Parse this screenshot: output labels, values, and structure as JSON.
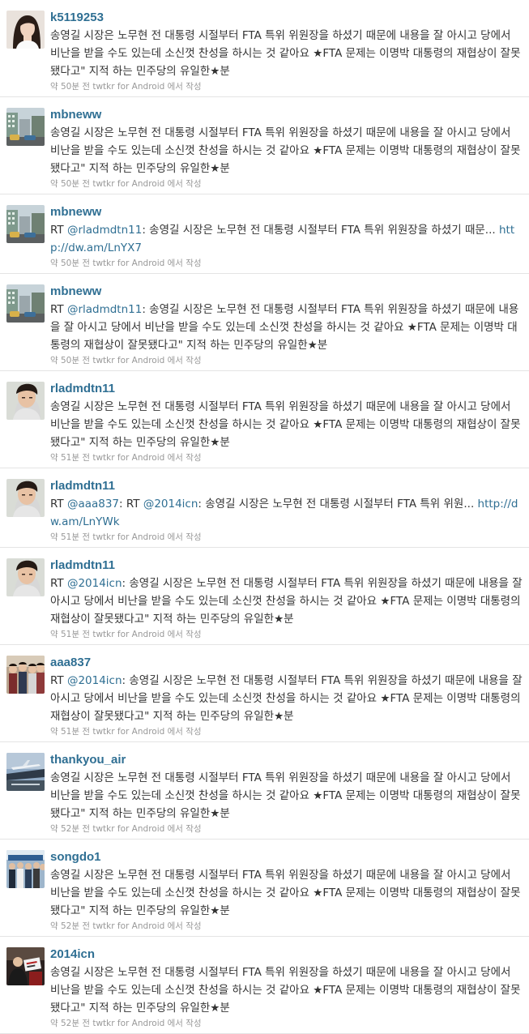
{
  "tweets": [
    {
      "username": "k5119253",
      "avatar_icon": "woman-portrait-avatar",
      "segments": [
        {
          "type": "text",
          "value": "송영길 시장은 노무현 전 대통령 시절부터 FTA 특위 위원장을 하셨기 때문에 내용을 잘 아시고 당에서 비난을 받을 수도 있는데 소신껏 찬성을 하시는 것 같아요 ★FTA 문제는 이명박 대통령의 재협상이 잘못됐다고\" 지적 하는 민주당의 유일한★분"
        }
      ],
      "meta": "약 50분 전 twtkr for Android 에서 작성"
    },
    {
      "username": "mbneww",
      "avatar_icon": "city-street-avatar",
      "segments": [
        {
          "type": "text",
          "value": "송영길 시장은 노무현 전 대통령 시절부터 FTA 특위 위원장을 하셨기 때문에 내용을 잘 아시고 당에서 비난을 받을 수도 있는데 소신껏 찬성을 하시는 것 같아요 ★FTA 문제는 이명박 대통령의 재협상이 잘못됐다고\" 지적 하는 민주당의 유일한★분"
        }
      ],
      "meta": "약 50분 전 twtkr for Android 에서 작성"
    },
    {
      "username": "mbneww",
      "avatar_icon": "city-street-avatar",
      "segments": [
        {
          "type": "text",
          "value": "RT "
        },
        {
          "type": "mention",
          "value": "@rladmdtn11"
        },
        {
          "type": "text",
          "value": ": 송영길 시장은 노무현 전 대통령 시절부터 FTA 특위 위원장을 하셨기 때문... "
        },
        {
          "type": "link",
          "value": "http://dw.am/LnYX7"
        }
      ],
      "meta": "약 50분 전 twtkr for Android 에서 작성"
    },
    {
      "username": "mbneww",
      "avatar_icon": "city-street-avatar",
      "segments": [
        {
          "type": "text",
          "value": "RT "
        },
        {
          "type": "mention",
          "value": "@rladmdtn11"
        },
        {
          "type": "text",
          "value": ": 송영길 시장은 노무현 전 대통령 시절부터 FTA 특위 위원장을 하셨기 때문에 내용을 잘 아시고 당에서 비난을 받을 수도 있는데 소신껏 찬성을 하시는 것 같아요 ★FTA 문제는 이명박 대통령의 재협상이 잘못됐다고\" 지적 하는 민주당의 유일한★분"
        }
      ],
      "meta": "약 50분 전 twtkr for Android 에서 작성"
    },
    {
      "username": "rladmdtn11",
      "avatar_icon": "boy-portrait-avatar",
      "segments": [
        {
          "type": "text",
          "value": "송영길 시장은 노무현 전 대통령 시절부터 FTA 특위 위원장을 하셨기 때문에 내용을 잘 아시고 당에서 비난을 받을 수도 있는데 소신껏 찬성을 하시는 것 같아요 ★FTA 문제는 이명박 대통령의 재협상이 잘못됐다고\" 지적 하는 민주당의 유일한★분"
        }
      ],
      "meta": "약 51분 전 twtkr for Android 에서 작성"
    },
    {
      "username": "rladmdtn11",
      "avatar_icon": "boy-portrait-avatar",
      "segments": [
        {
          "type": "text",
          "value": "RT "
        },
        {
          "type": "mention",
          "value": "@aaa837"
        },
        {
          "type": "text",
          "value": ": RT "
        },
        {
          "type": "mention",
          "value": "@2014icn"
        },
        {
          "type": "text",
          "value": ": 송영길 시장은 노무현 전 대통령 시절부터 FTA 특위 위원... "
        },
        {
          "type": "link",
          "value": "http://dw.am/LnYWk"
        }
      ],
      "meta": "약 51분 전 twtkr for Android 에서 작성"
    },
    {
      "username": "rladmdtn11",
      "avatar_icon": "boy-portrait-avatar",
      "segments": [
        {
          "type": "text",
          "value": "RT "
        },
        {
          "type": "mention",
          "value": "@2014icn"
        },
        {
          "type": "text",
          "value": ": 송영길 시장은 노무현 전 대통령 시절부터 FTA 특위 위원장을 하셨기 때문에 내용을 잘 아시고 당에서 비난을 받을 수도 있는데 소신껏 찬성을 하시는 것 같아요 ★FTA 문제는 이명박 대통령의 재협상이 잘못됐다고\" 지적 하는 민주당의 유일한★분"
        }
      ],
      "meta": "약 51분 전 twtkr for Android 에서 작성"
    },
    {
      "username": "aaa837",
      "avatar_icon": "group-photo-avatar",
      "segments": [
        {
          "type": "text",
          "value": "RT "
        },
        {
          "type": "mention",
          "value": "@2014icn"
        },
        {
          "type": "text",
          "value": ": 송영길 시장은 노무현 전 대통령 시절부터 FTA 특위 위원장을 하셨기 때문에 내용을 잘 아시고 당에서 비난을 받을 수도 있는데 소신껏 찬성을 하시는 것 같아요 ★FTA 문제는 이명박 대통령의 재협상이 잘못됐다고\" 지적 하는 민주당의 유일한★분"
        }
      ],
      "meta": "약 51분 전 twtkr for Android 에서 작성"
    },
    {
      "username": "thankyou_air",
      "avatar_icon": "airport-avatar",
      "segments": [
        {
          "type": "text",
          "value": "송영길 시장은 노무현 전 대통령 시절부터 FTA 특위 위원장을 하셨기 때문에 내용을 잘 아시고 당에서 비난을 받을 수도 있는데 소신껏 찬성을 하시는 것 같아요 ★FTA 문제는 이명박 대통령의 재협상이 잘못됐다고\" 지적 하는 민주당의 유일한★분"
        }
      ],
      "meta": "약 52분 전 twtkr for Android 에서 작성"
    },
    {
      "username": "songdo1",
      "avatar_icon": "crowd-photo-avatar",
      "segments": [
        {
          "type": "text",
          "value": "송영길 시장은 노무현 전 대통령 시절부터 FTA 특위 위원장을 하셨기 때문에 내용을 잘 아시고 당에서 비난을 받을 수도 있는데 소신껏 찬성을 하시는 것 같아요 ★FTA 문제는 이명박 대통령의 재협상이 잘못됐다고\" 지적 하는 민주당의 유일한★분"
        }
      ],
      "meta": "약 52분 전 twtkr for Android 에서 작성"
    },
    {
      "username": "2014icn",
      "avatar_icon": "rally-photo-avatar",
      "segments": [
        {
          "type": "text",
          "value": "송영길 시장은 노무현 전 대통령 시절부터 FTA 특위 위원장을 하셨기 때문에 내용을 잘 아시고 당에서 비난을 받을 수도 있는데 소신껏 찬성을 하시는 것 같아요 ★FTA 문제는 이명박 대통령의 재협상이 잘못됐다고\" 지적 하는 민주당의 유일한★분"
        }
      ],
      "meta": "약 52분 전 twtkr for Android 에서 작성"
    }
  ]
}
